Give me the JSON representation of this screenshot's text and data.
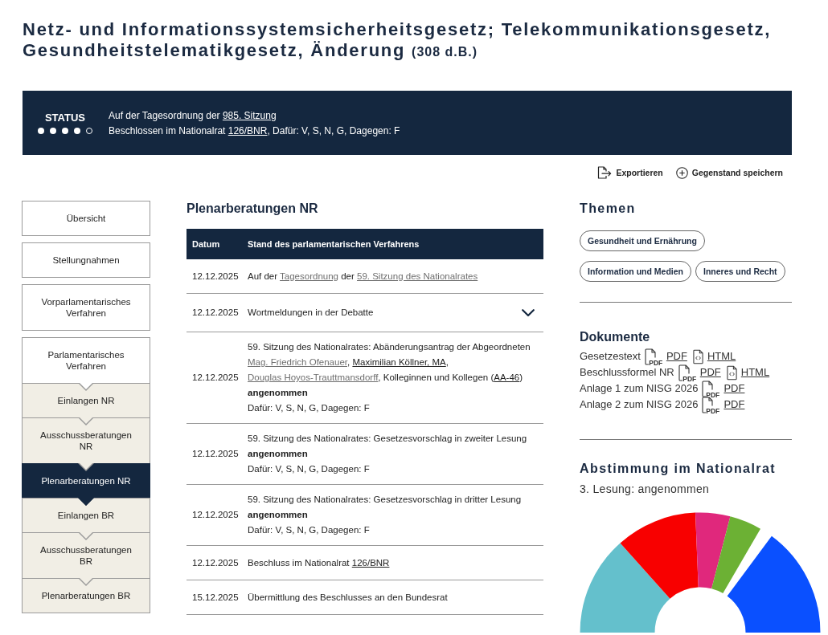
{
  "title": {
    "text": "Netz- und Informationssystemsicherheitsgesetz; Telekommunikationsgesetz, Gesundheitstelematikgesetz, Änderung",
    "suffix": "(308 d.B.)"
  },
  "status": {
    "label": "STATUS",
    "steps": [
      {
        "filled": true
      },
      {
        "filled": true
      },
      {
        "filled": true
      },
      {
        "filled": true
      },
      {
        "filled": false
      }
    ],
    "lines": [
      {
        "parts": [
          {
            "kind": "text",
            "text": "Auf der Tagesordnung der "
          },
          {
            "kind": "link",
            "text": "985. Sitzung"
          }
        ]
      },
      {
        "parts": [
          {
            "kind": "text",
            "text": "Beschlossen im Nationalrat "
          },
          {
            "kind": "link",
            "text": "126/BNR"
          },
          {
            "kind": "text",
            "text": ", Dafür: V, S, N, G, Dagegen: F"
          }
        ]
      }
    ]
  },
  "actions": [
    {
      "kind": "export",
      "label": "Exportieren"
    },
    {
      "kind": "save",
      "label": "Gegenstand speichern"
    }
  ],
  "nav": [
    {
      "label": "Übersicht",
      "selected": false
    },
    {
      "label": "Stellungnahmen",
      "selected": false
    },
    {
      "label": "Vorparlamentarisches Verfahren",
      "selected": false
    },
    {
      "label": "Parlamentarisches Verfahren",
      "selected": false,
      "children": [
        {
          "label": "Einlangen NR",
          "selected": false
        },
        {
          "label": "Ausschussberatungen NR",
          "selected": false
        },
        {
          "label": "Plenarberatungen NR",
          "selected": true
        },
        {
          "label": "Einlangen BR",
          "selected": false
        },
        {
          "label": "Ausschussberatungen BR",
          "selected": false
        },
        {
          "label": "Plenarberatungen BR",
          "selected": false
        }
      ]
    }
  ],
  "procedure": {
    "heading": "Plenarberatungen NR",
    "columns": [
      "Datum",
      "Stand des parlamentarischen Verfahrens"
    ],
    "rows": [
      {
        "kind": "entry",
        "date": "12.12.2025",
        "parts": [
          {
            "kind": "text",
            "text": "Auf der "
          },
          {
            "kind": "visited-link",
            "text": "Tagesordnung"
          },
          {
            "kind": "text",
            "text": " der "
          },
          {
            "kind": "visited-link",
            "text": "59. Sitzung des Nationalrates"
          }
        ]
      },
      {
        "kind": "expandable",
        "expanded": false,
        "date": "12.12.2025",
        "parts": [
          {
            "kind": "text",
            "text": "Wortmeldungen in der Debatte"
          }
        ]
      },
      {
        "kind": "entry",
        "date": "12.12.2025",
        "parts": [
          {
            "kind": "text",
            "text": "59. Sitzung des Nationalrates: Abänderungsantrag der Abgeordneten "
          },
          {
            "kind": "visited-link",
            "text": "Mag. Friedrich Ofenauer"
          },
          {
            "kind": "text",
            "text": ", "
          },
          {
            "kind": "link",
            "text": "Maximilian Köllner, MA"
          },
          {
            "kind": "text",
            "text": ", "
          },
          {
            "kind": "visited-link",
            "text": "Douglas Hoyos-Trauttmansdorff"
          },
          {
            "kind": "text",
            "text": ", Kolleginnen und Kollegen ("
          },
          {
            "kind": "link",
            "text": "AA-46"
          },
          {
            "kind": "text",
            "text": ")"
          }
        ],
        "result": "angenommen",
        "votes": "Dafür: V, S, N, G, Dagegen: F"
      },
      {
        "kind": "entry",
        "date": "12.12.2025",
        "parts": [
          {
            "kind": "text",
            "text": "59. Sitzung des Nationalrates: Gesetzesvorschlag in zweiter Lesung"
          }
        ],
        "result": "angenommen",
        "votes": "Dafür: V, S, N, G, Dagegen: F"
      },
      {
        "kind": "entry",
        "date": "12.12.2025",
        "parts": [
          {
            "kind": "text",
            "text": "59. Sitzung des Nationalrates: Gesetzesvorschlag in dritter Lesung"
          }
        ],
        "result": "angenommen",
        "votes": "Dafür: V, S, N, G, Dagegen: F"
      },
      {
        "kind": "entry",
        "date": "12.12.2025",
        "parts": [
          {
            "kind": "text",
            "text": "Beschluss im Nationalrat "
          },
          {
            "kind": "link",
            "text": "126/BNR"
          }
        ]
      },
      {
        "kind": "entry",
        "date": "15.12.2025",
        "parts": [
          {
            "kind": "text",
            "text": "Übermittlung des Beschlusses an den Bundesrat"
          }
        ]
      }
    ]
  },
  "topics": {
    "heading": "Themen",
    "tags": [
      "Gesundheit und Ernährung",
      "Information und Medien",
      "Inneres und Recht"
    ]
  },
  "documents": {
    "heading": "Dokumente",
    "items": [
      {
        "name": "Gesetzestext",
        "files": [
          {
            "kind": "pdf",
            "icon_text": "PDF",
            "label": "PDF"
          },
          {
            "kind": "html",
            "label": "HTML"
          }
        ]
      },
      {
        "name": "Beschlussformel NR",
        "files": [
          {
            "kind": "pdf",
            "icon_text": "PDF",
            "label": "PDF"
          },
          {
            "kind": "html",
            "label": "HTML"
          }
        ]
      },
      {
        "name": "Anlage 1 zum NISG 2026",
        "files": [
          {
            "kind": "pdf",
            "icon_text": "PDF",
            "label": "PDF"
          }
        ]
      },
      {
        "name": "Anlage 2 zum NISG 2026",
        "files": [
          {
            "kind": "pdf",
            "icon_text": "PDF",
            "label": "PDF"
          }
        ]
      }
    ]
  },
  "vote": {
    "heading": "Abstimmung im Nationalrat",
    "result": "3. Lesung: angenommen"
  }
}
